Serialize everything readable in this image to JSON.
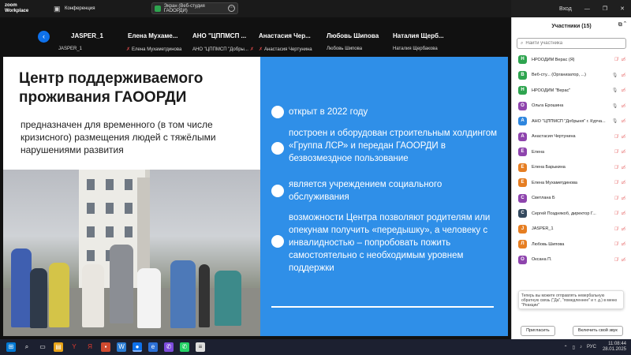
{
  "titlebar": {
    "logo": "zoom\nWorkplace",
    "conference_label": "Конференция",
    "share_label": "Экран (Веб-студия ГАООРДИ)",
    "signin": "Вход"
  },
  "video_strip": [
    {
      "big": "JASPER_1",
      "small": "JASPER_1",
      "muted": false
    },
    {
      "big": "Елена  Мухаме...",
      "small": "Елена Мухаметдинова",
      "muted": true
    },
    {
      "big": "АНО \"ЦППМСП ...",
      "small": "АНО \"ЦППМСП \"Добры...",
      "muted": true
    },
    {
      "big": "Анастасия Чер...",
      "small": "Анастасия Чертунина",
      "muted": true
    },
    {
      "big": "Любовь Шипова",
      "small": "Любовь Шипова",
      "muted": false
    },
    {
      "big": "Наталия Щерб...",
      "small": "Наталия Щербакова",
      "muted": false
    }
  ],
  "slide": {
    "title": "Центр поддерживаемого проживания ГАООРДИ",
    "subtitle": "предназначен для временного (в том числе кризисного) размещения людей с тяжёлыми нарушениями развития",
    "bullets": [
      "открыт в 2022 году",
      "построен и оборудован строительным холдингом «Группа ЛСР» и передан ГАООРДИ в безвозмездное пользование",
      "является учреждением социального обслуживания",
      "возможности Центра позволяют родителям или опекунам получить «передышку», а человеку с инвалидностью – попробовать пожить самостоятельно с необходимым уровнем поддержки"
    ]
  },
  "panel": {
    "title": "Участники (15)",
    "search_placeholder": "Найти участника",
    "participants": [
      {
        "initial": "Н",
        "name": "НРООДИМ Верас (Я)",
        "color": "#2ea44f",
        "mic": "off",
        "video": "off"
      },
      {
        "initial": "В",
        "name": "Веб-сту... (Организатор, ...)",
        "color": "#2ea44f",
        "mic": "on",
        "video": "off"
      },
      {
        "initial": "Н",
        "name": "НРООДИМ \"Верас\"",
        "color": "#2ea44f",
        "mic": "on",
        "video": "off"
      },
      {
        "initial": "О",
        "name": "Ольга Ерошина",
        "color": "#8e44ad",
        "mic": "on",
        "video": "off"
      },
      {
        "initial": "А",
        "name": "АНО \"ЦППМСП \"Добрыня\" г. Курча...",
        "color": "#2e86de",
        "mic": "on",
        "video": "off"
      },
      {
        "initial": "А",
        "name": "Анастасия Чертунина",
        "color": "#8e44ad",
        "mic": "off",
        "video": "off"
      },
      {
        "initial": "Е",
        "name": "Елена",
        "color": "#8e44ad",
        "mic": "off",
        "video": "off"
      },
      {
        "initial": "Е",
        "name": "Елена Барыкина",
        "color": "#e67e22",
        "mic": "off",
        "video": "off"
      },
      {
        "initial": "Е",
        "name": "Елена Мухаметдинова",
        "color": "#e67e22",
        "mic": "off",
        "video": "off"
      },
      {
        "initial": "С",
        "name": "Светлана Б",
        "color": "#8e44ad",
        "mic": "off",
        "video": "off"
      },
      {
        "initial": "С",
        "name": "Сергей Позднякоб, директор Г...",
        "color": "#34495e",
        "mic": "off",
        "video": "off"
      },
      {
        "initial": "J",
        "name": "JASPER_1",
        "color": "#e67e22",
        "mic": "off",
        "video": "off"
      },
      {
        "initial": "Л",
        "name": "Любовь Шипова",
        "color": "#e67e22",
        "mic": "off",
        "video": "off"
      },
      {
        "initial": "О",
        "name": "Оксана П.",
        "color": "#8e44ad",
        "mic": "off",
        "video": "off"
      }
    ],
    "toast": "Теперь вы можете отправлять невербальную обратную связь (\"Да\", \"помедленнее\" и т. д.) в меню \"Реакции\"",
    "invite_label": "Пригласить",
    "unmute_label": "Включить свой звук"
  },
  "taskbar": {
    "lang": "РУС",
    "time": "11:08:44",
    "date": "28.01.2025"
  }
}
